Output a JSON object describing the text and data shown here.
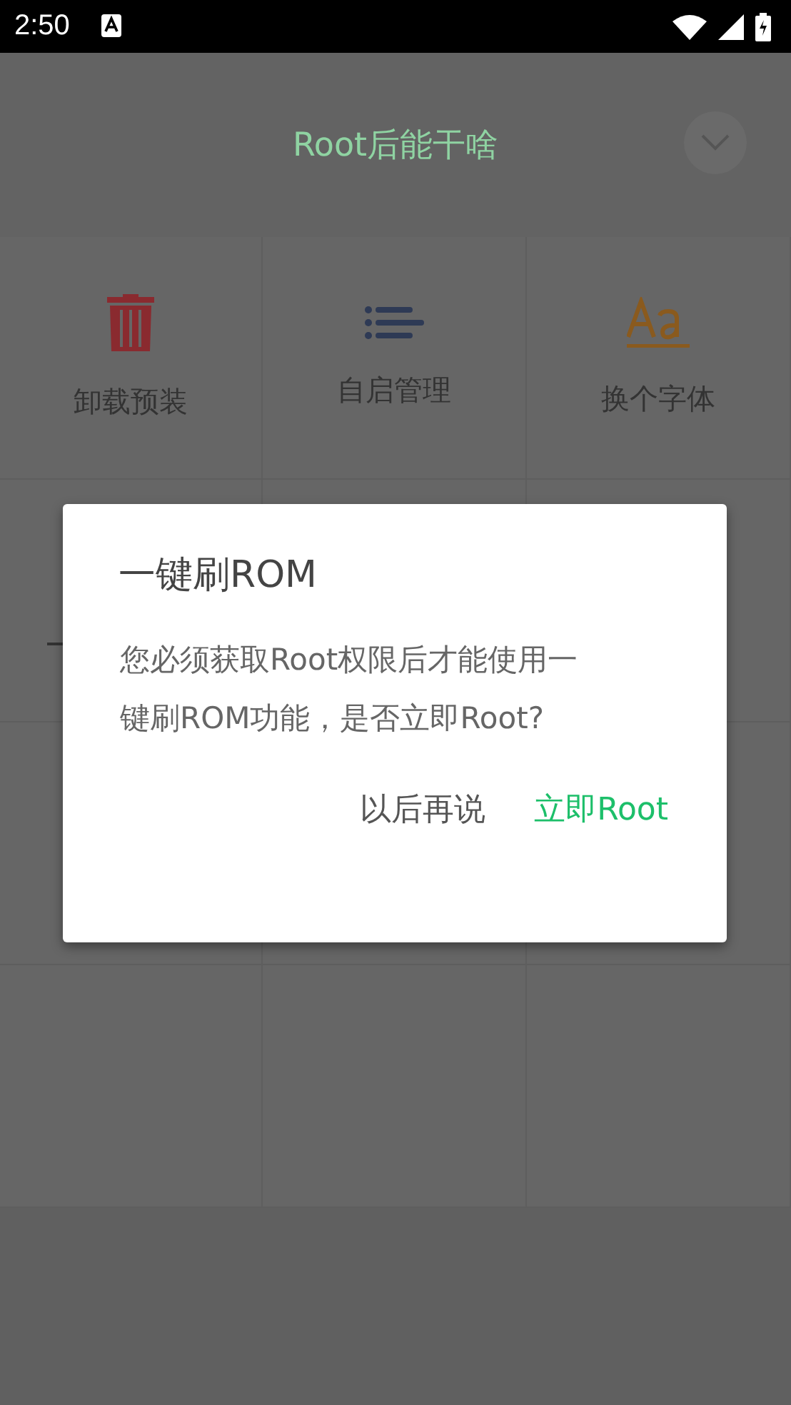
{
  "status_bar": {
    "time": "2:50"
  },
  "header": {
    "title": "Root后能干啥"
  },
  "tools": [
    {
      "label": "卸载预装",
      "kind": "trash"
    },
    {
      "label": "自启管理",
      "kind": "list"
    },
    {
      "label": "换个字体",
      "kind": "font"
    }
  ],
  "dialog": {
    "title": "一键刷ROM",
    "message": "您必须获取Root权限后才能使用一键刷ROM功能，是否立即Root?",
    "buttons": [
      {
        "label": "以后再说",
        "kind": "secondary"
      },
      {
        "label": "立即Root",
        "kind": "primary"
      }
    ]
  }
}
